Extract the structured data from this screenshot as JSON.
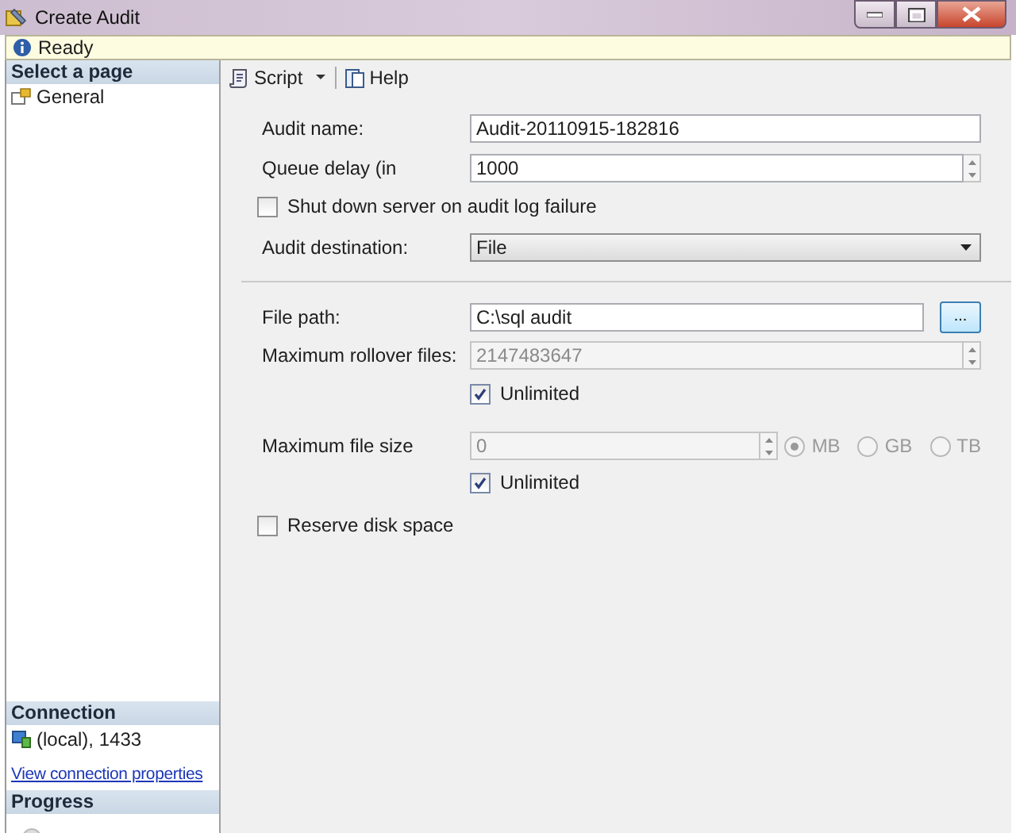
{
  "window": {
    "title": "Create Audit"
  },
  "status": {
    "text": "Ready"
  },
  "sidebar": {
    "select_header": "Select a page",
    "pages": [
      {
        "label": "General",
        "selected": false
      }
    ],
    "connection_header": "Connection",
    "connection": "(local), 1433",
    "connection_link": "View connection properties",
    "progress_header": "Progress"
  },
  "toolbar": [
    {
      "kind": "script",
      "label": "Script"
    },
    {
      "kind": "help",
      "label": "Help"
    }
  ],
  "form": {
    "audit_name": {
      "label": "Audit name:",
      "value": "Audit-20110915-182816"
    },
    "queue_delay": {
      "label": "Queue delay (in",
      "value": "1000"
    },
    "shutdown": {
      "label": "Shut down server on audit log failure",
      "checked": false
    },
    "destination": {
      "label": "Audit destination:",
      "value": "File"
    },
    "file_path": {
      "label": "File path:",
      "value": "C:\\sql audit",
      "browse": "..."
    },
    "max_rollover": {
      "label": "Maximum rollover files:",
      "value": "2147483647",
      "disabled": true,
      "unlimited": {
        "label": "Unlimited",
        "checked": true
      }
    },
    "max_file_size": {
      "label": "Maximum file size",
      "value": "0",
      "disabled": true,
      "units": [
        {
          "label": "MB",
          "selected": true
        },
        {
          "label": "GB",
          "selected": false
        },
        {
          "label": "TB",
          "selected": false
        }
      ],
      "unlimited": {
        "label": "Unlimited",
        "checked": true
      }
    },
    "reserve": {
      "label": "Reserve disk space",
      "checked": false
    }
  }
}
